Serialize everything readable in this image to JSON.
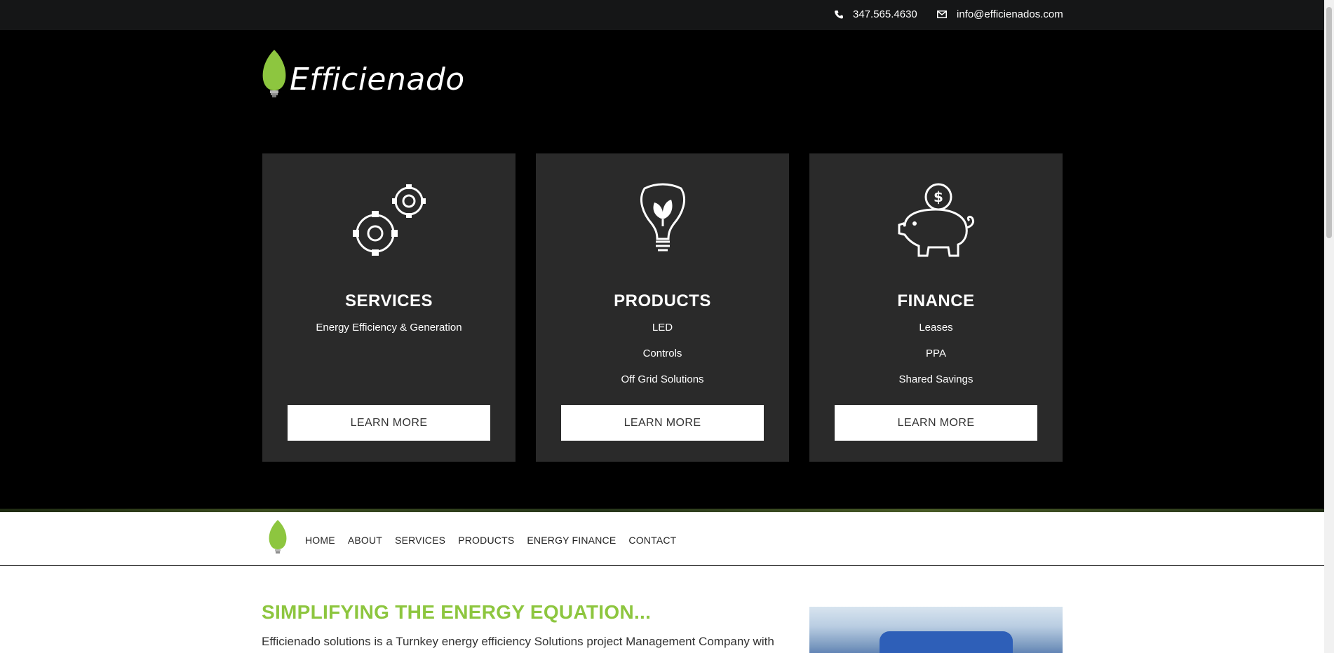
{
  "topbar": {
    "phone": "347.565.4630",
    "email": "info@efficienados.com"
  },
  "logo": {
    "text": "Efficienado"
  },
  "cards": [
    {
      "title": "SERVICES",
      "items": [
        "Energy Efficiency & Generation"
      ],
      "button": "LEARN MORE",
      "icon": "gears-icon"
    },
    {
      "title": "PRODUCTS",
      "items": [
        "LED",
        "Controls",
        "Off Grid Solutions"
      ],
      "button": "LEARN MORE",
      "icon": "lightbulb-leaf-icon"
    },
    {
      "title": "FINANCE",
      "items": [
        "Leases",
        "PPA",
        "Shared Savings"
      ],
      "button": "LEARN MORE",
      "icon": "piggy-bank-icon"
    }
  ],
  "nav": {
    "items": [
      "HOME",
      "ABOUT",
      "SERVICES",
      "PRODUCTS",
      "ENERGY FINANCE",
      "CONTACT"
    ]
  },
  "content": {
    "heading": "SIMPLIFYING THE ENERGY EQUATION...",
    "paragraph": "Efficienado solutions is a Turnkey energy efficiency Solutions project Management Company with"
  },
  "colors": {
    "accent": "#8dc63f",
    "card_bg": "#2a2a2a",
    "topbar_bg": "#151617"
  }
}
